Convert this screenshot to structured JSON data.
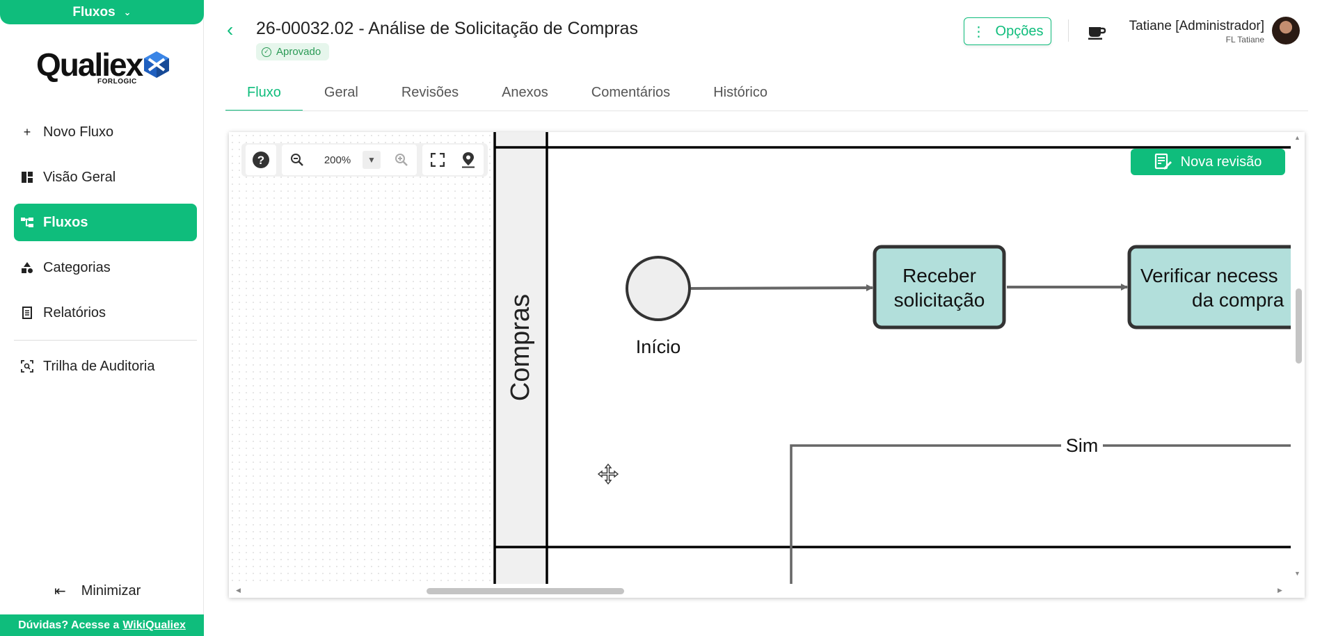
{
  "module": {
    "label": "Fluxos"
  },
  "logo": {
    "name": "Qualiex",
    "sub": "FORLOGIC"
  },
  "sidebar": {
    "items": [
      {
        "label": "Novo Fluxo"
      },
      {
        "label": "Visão Geral"
      },
      {
        "label": "Fluxos"
      },
      {
        "label": "Categorias"
      },
      {
        "label": "Relatórios"
      },
      {
        "label": "Trilha de Auditoria"
      }
    ],
    "minimize_label": "Minimizar",
    "help_text": "Dúvidas? Acesse a",
    "help_link": "WikiQualiex"
  },
  "header": {
    "title": "26-00032.02 - Análise de Solicitação de Compras",
    "status": "Aprovado",
    "options_label": "Opções",
    "user_name": "Tatiane [Administrador]",
    "user_sub": "FL Tatiane"
  },
  "tabs": [
    {
      "label": "Fluxo"
    },
    {
      "label": "Geral"
    },
    {
      "label": "Revisões"
    },
    {
      "label": "Anexos"
    },
    {
      "label": "Comentários"
    },
    {
      "label": "Histórico"
    }
  ],
  "toolbar": {
    "zoom": "200%"
  },
  "nova_revisao_label": "Nova revisão",
  "diagram": {
    "lane": "Compras",
    "start_label": "Início",
    "task1_line1": "Receber",
    "task1_line2": "solicitação",
    "task2_line1": "Verificar necess",
    "task2_line2": "da compra",
    "gateway_label": "Sim"
  },
  "colors": {
    "accent": "#0fbd7c",
    "task_fill": "#b2dfdb"
  }
}
